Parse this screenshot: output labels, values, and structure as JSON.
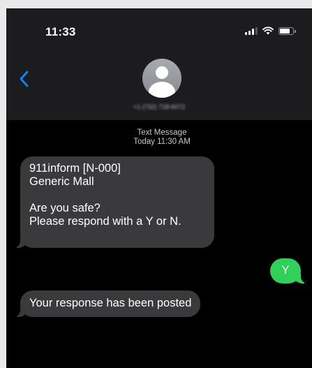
{
  "status_bar": {
    "time": "11:33",
    "icons": [
      "cellular-signal-icon",
      "wifi-icon",
      "battery-icon"
    ]
  },
  "header": {
    "back_icon": "chevron-left-icon",
    "avatar_icon": "person-icon",
    "contact_number": "+1 (732) 718-6072"
  },
  "thread": {
    "timestamp_label": "Text Message",
    "timestamp_time": "Today 11:30 AM",
    "messages": [
      {
        "direction": "incoming",
        "text": "911inform [N-000]\nGeneric Mall\n\nAre you safe?\nPlease respond with a Y or N."
      },
      {
        "direction": "outgoing",
        "text": "Y"
      },
      {
        "direction": "incoming",
        "text": "Your response has been posted"
      }
    ]
  },
  "colors": {
    "background": "#000000",
    "header_background": "#1c1c1e",
    "incoming_bubble": "#3a3a3c",
    "outgoing_bubble": "#30d158",
    "accent_blue": "#0a84ff"
  }
}
